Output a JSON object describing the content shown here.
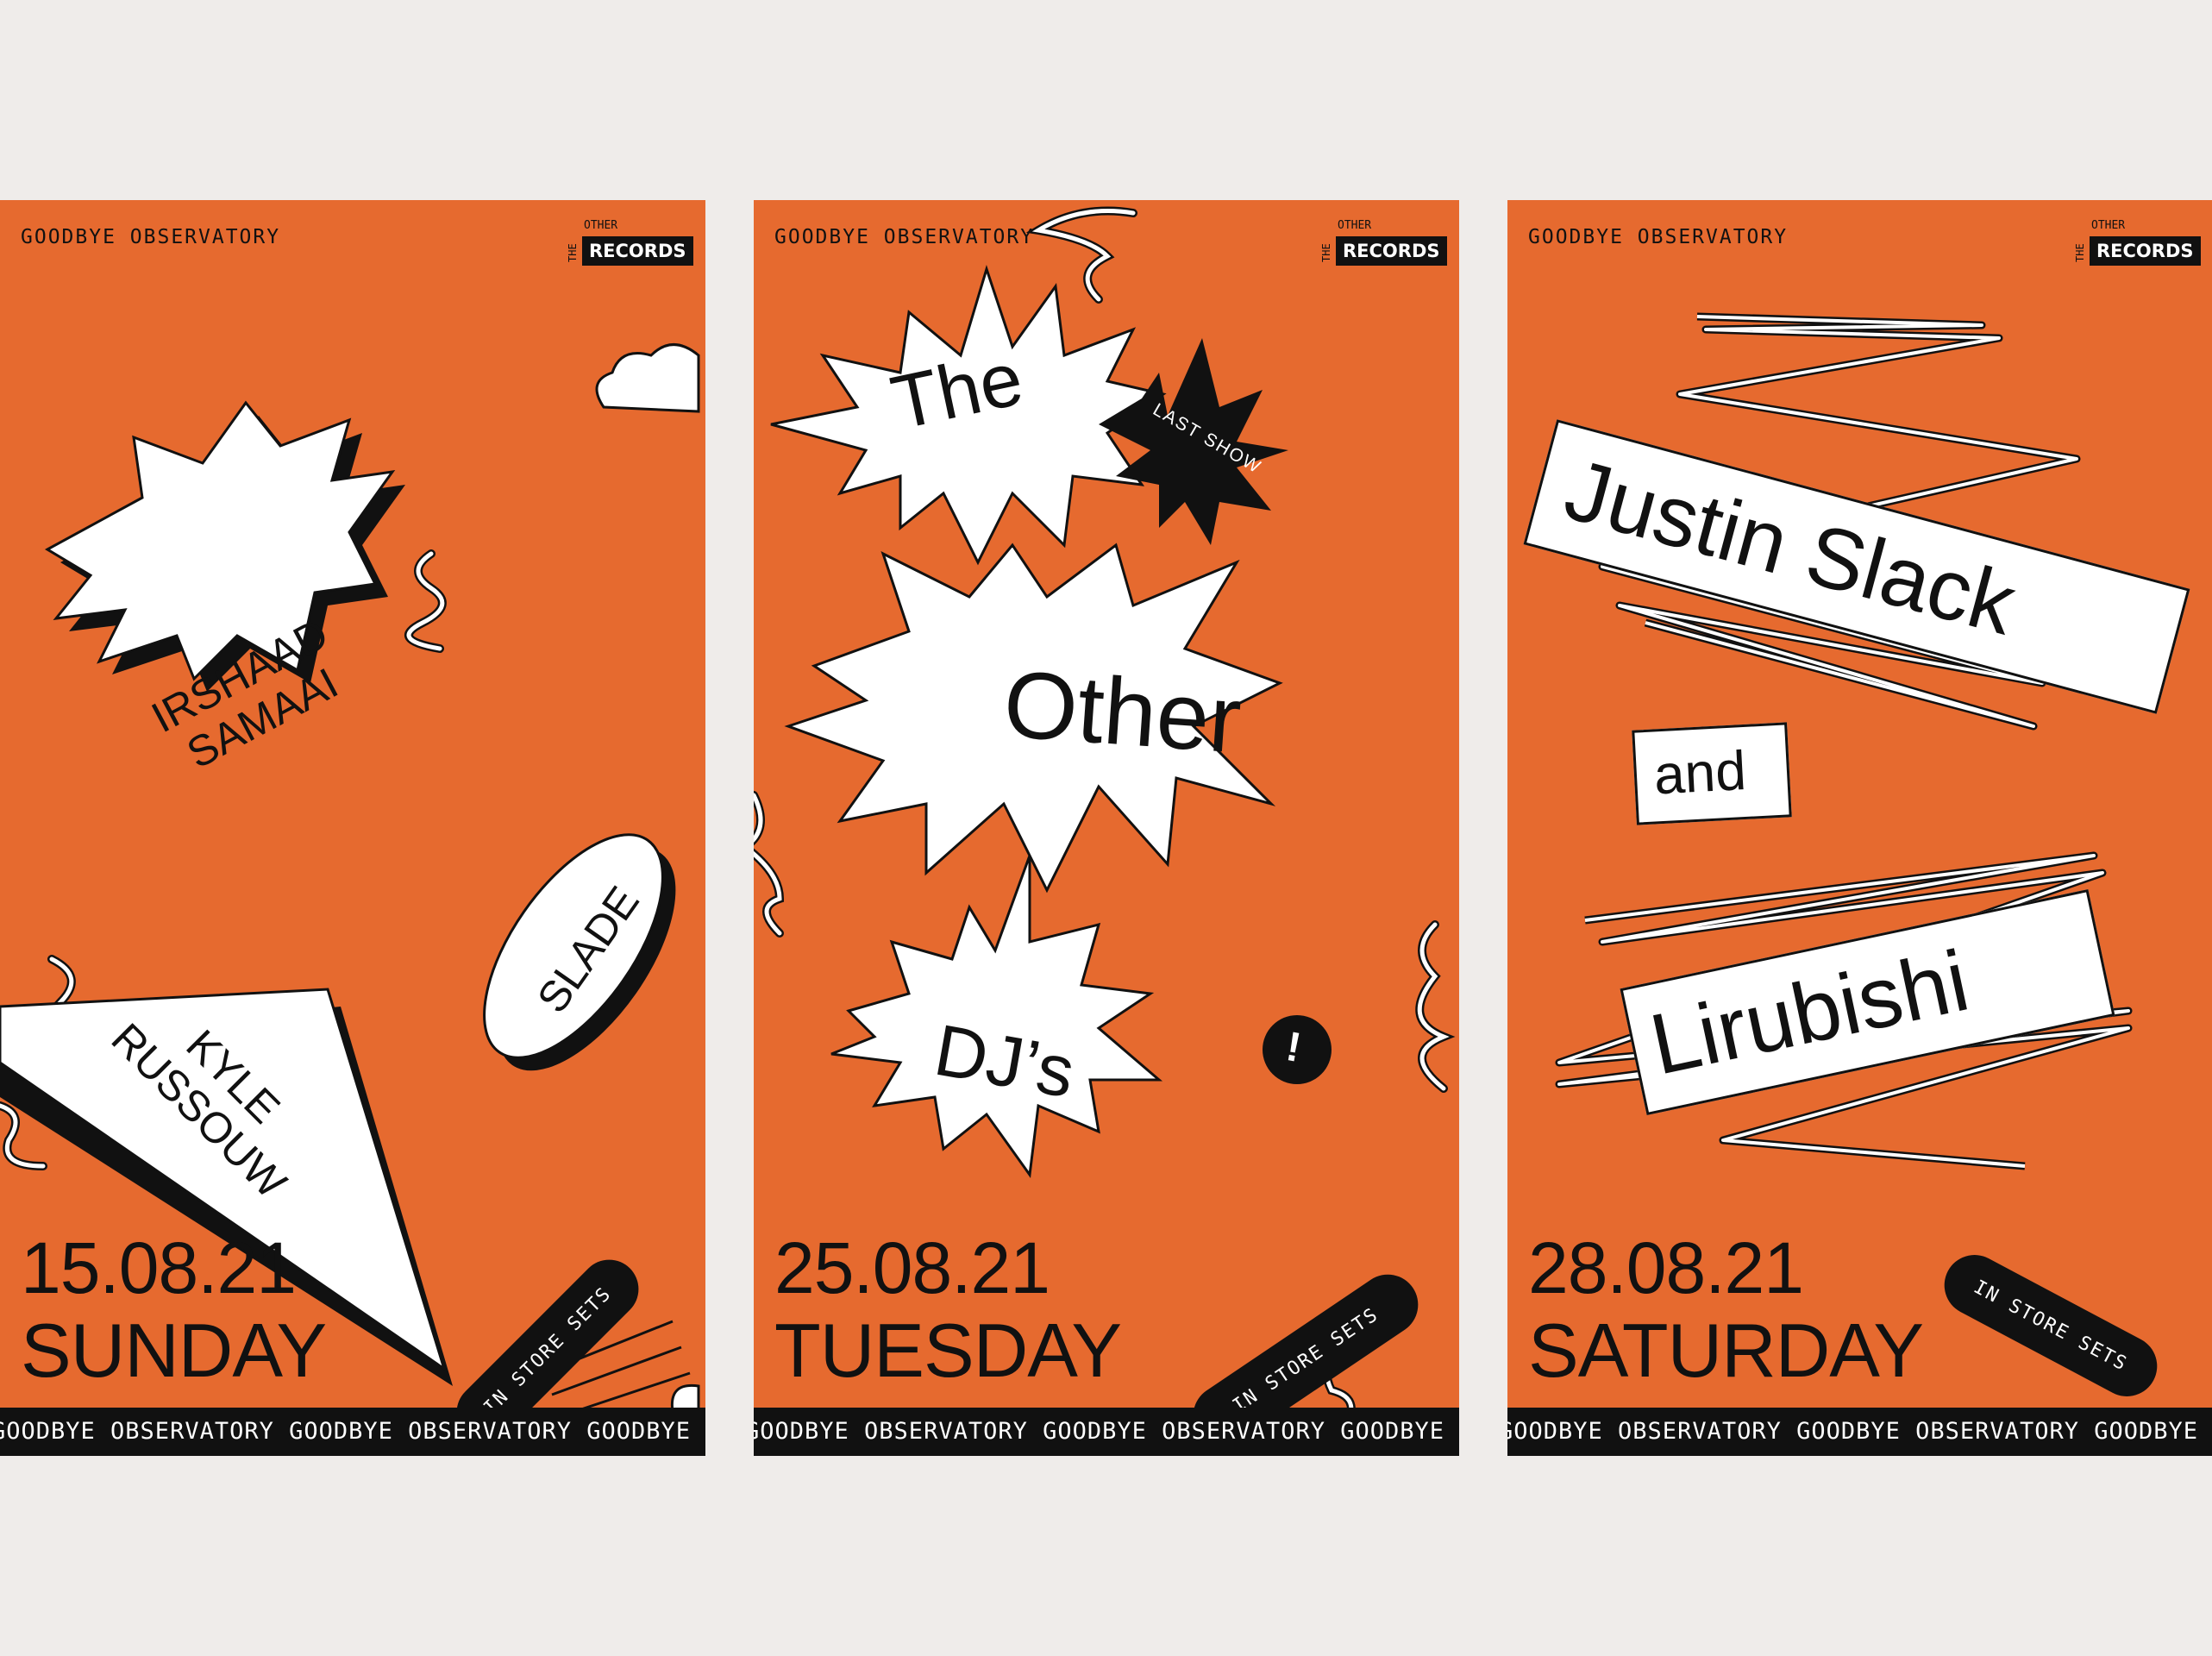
{
  "posters": [
    {
      "header": "GOODBYE OBSERVATORY",
      "logo": {
        "the": "THE",
        "other": "OTHER",
        "records": "RECORDS"
      },
      "artists": [
        "IRSHAAD",
        "SAMAAI",
        "SLADE",
        "KYLE",
        "RUSSOUW"
      ],
      "badge": "IN STORE SETS",
      "date": "15.08.21",
      "day": "SUNDAY",
      "ticker": "GOODBYE OBSERVATORY GOODBYE OBSERVATORY GOODBYE OBSERVATORY"
    },
    {
      "header": "GOODBYE OBSERVATORY",
      "logo": {
        "the": "THE",
        "other": "OTHER",
        "records": "RECORDS"
      },
      "words": [
        "The",
        "Other",
        "DJ’s"
      ],
      "tag": "LAST SHOW",
      "exclaim": "!",
      "badge": "IN STORE SETS",
      "date": "25.08.21",
      "day": "TUESDAY",
      "ticker": "GOODBYE OBSERVATORY GOODBYE OBSERVATORY GOODBYE OBSERVATORY"
    },
    {
      "header": "GOODBYE OBSERVATORY",
      "logo": {
        "the": "THE",
        "other": "OTHER",
        "records": "RECORDS"
      },
      "artists": [
        "Justin Slack",
        "and",
        "Lirubishi"
      ],
      "badge": "IN STORE SETS",
      "date": "28.08.21",
      "day": "SATURDAY",
      "ticker": "GOODBYE OBSERVATORY GOODBYE OBSERVATORY GOODBYE OBSERVATORY"
    }
  ],
  "colors": {
    "poster_bg": "#e66a2f",
    "page_bg": "#efecea",
    "ink": "#111111",
    "paper": "#ffffff"
  }
}
